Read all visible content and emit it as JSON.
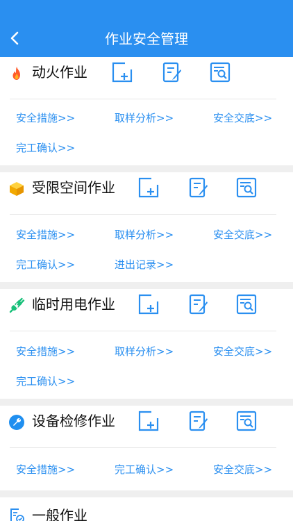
{
  "header": {
    "title": "作业安全管理"
  },
  "colors": {
    "accent": "#2a8ff0",
    "fire": "#ff5b2b",
    "box": "#f6b500",
    "electric": "#19c07a",
    "wrench": "#1f8ff0"
  },
  "sections": [
    {
      "title": "动火作业",
      "icon": "flame-icon",
      "links": [
        "安全措施>>",
        "取样分析>>",
        "安全交底>>",
        "完工确认>>"
      ]
    },
    {
      "title": "受限空间作业",
      "icon": "box-icon",
      "links": [
        "安全措施>>",
        "取样分析>>",
        "安全交底>>",
        "完工确认>>",
        "进出记录>>"
      ]
    },
    {
      "title": "临时用电作业",
      "icon": "plug-icon",
      "links": [
        "安全措施>>",
        "取样分析>>",
        "安全交底>>",
        "完工确认>>"
      ]
    },
    {
      "title": "设备检修作业",
      "icon": "wrench-icon",
      "links": [
        "安全措施>>",
        "完工确认>>",
        "安全交底>>"
      ]
    },
    {
      "title": "一般作业",
      "icon": "document-check-icon",
      "links": []
    }
  ]
}
